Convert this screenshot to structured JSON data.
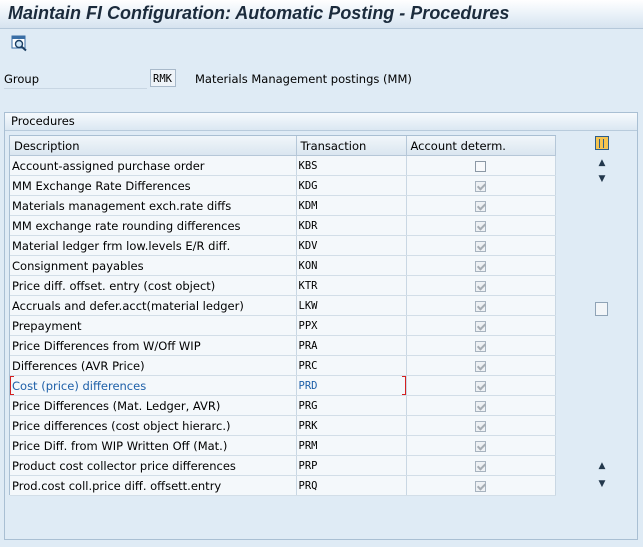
{
  "window": {
    "title": "Maintain FI Configuration: Automatic Posting - Procedures"
  },
  "toolbar": {
    "icons": [
      "find-icon"
    ]
  },
  "group": {
    "label": "Group",
    "value": "RMK",
    "description": "Materials Management postings (MM)"
  },
  "procedures": {
    "frame_title": "Procedures",
    "columns": [
      "Description",
      "Transaction",
      "Account determ."
    ],
    "rows": [
      {
        "description": "Account-assigned purchase order",
        "transaction": "KBS",
        "account_determ": false
      },
      {
        "description": "MM Exchange Rate Differences",
        "transaction": "KDG",
        "account_determ": true
      },
      {
        "description": "Materials management exch.rate diffs",
        "transaction": "KDM",
        "account_determ": true
      },
      {
        "description": "MM exchange rate rounding differences",
        "transaction": "KDR",
        "account_determ": true
      },
      {
        "description": "Material ledger frm low.levels E/R diff.",
        "transaction": "KDV",
        "account_determ": true
      },
      {
        "description": "Consignment payables",
        "transaction": "KON",
        "account_determ": true
      },
      {
        "description": "Price diff. offset. entry (cost object)",
        "transaction": "KTR",
        "account_determ": true
      },
      {
        "description": "Accruals and defer.acct(material ledger)",
        "transaction": "LKW",
        "account_determ": true
      },
      {
        "description": "Prepayment",
        "transaction": "PPX",
        "account_determ": true
      },
      {
        "description": "Price Differences from W/Off WIP",
        "transaction": "PRA",
        "account_determ": true
      },
      {
        "description": "Differences (AVR Price)",
        "transaction": "PRC",
        "account_determ": true
      },
      {
        "description": "Cost (price) differences",
        "transaction": "PRD",
        "account_determ": true,
        "selected": true
      },
      {
        "description": "Price Differences (Mat. Ledger, AVR)",
        "transaction": "PRG",
        "account_determ": true
      },
      {
        "description": "Price differences (cost object hierarc.)",
        "transaction": "PRK",
        "account_determ": true
      },
      {
        "description": "Price Diff. from WIP Written Off (Mat.)",
        "transaction": "PRM",
        "account_determ": true
      },
      {
        "description": "Product cost collector price differences",
        "transaction": "PRP",
        "account_determ": true
      },
      {
        "description": "Prod.cost coll.price diff. offsett.entry",
        "transaction": "PRQ",
        "account_determ": true
      }
    ]
  },
  "scrollbar": {
    "icons": [
      "arrow-up-icon",
      "arrow-down-icon"
    ]
  }
}
